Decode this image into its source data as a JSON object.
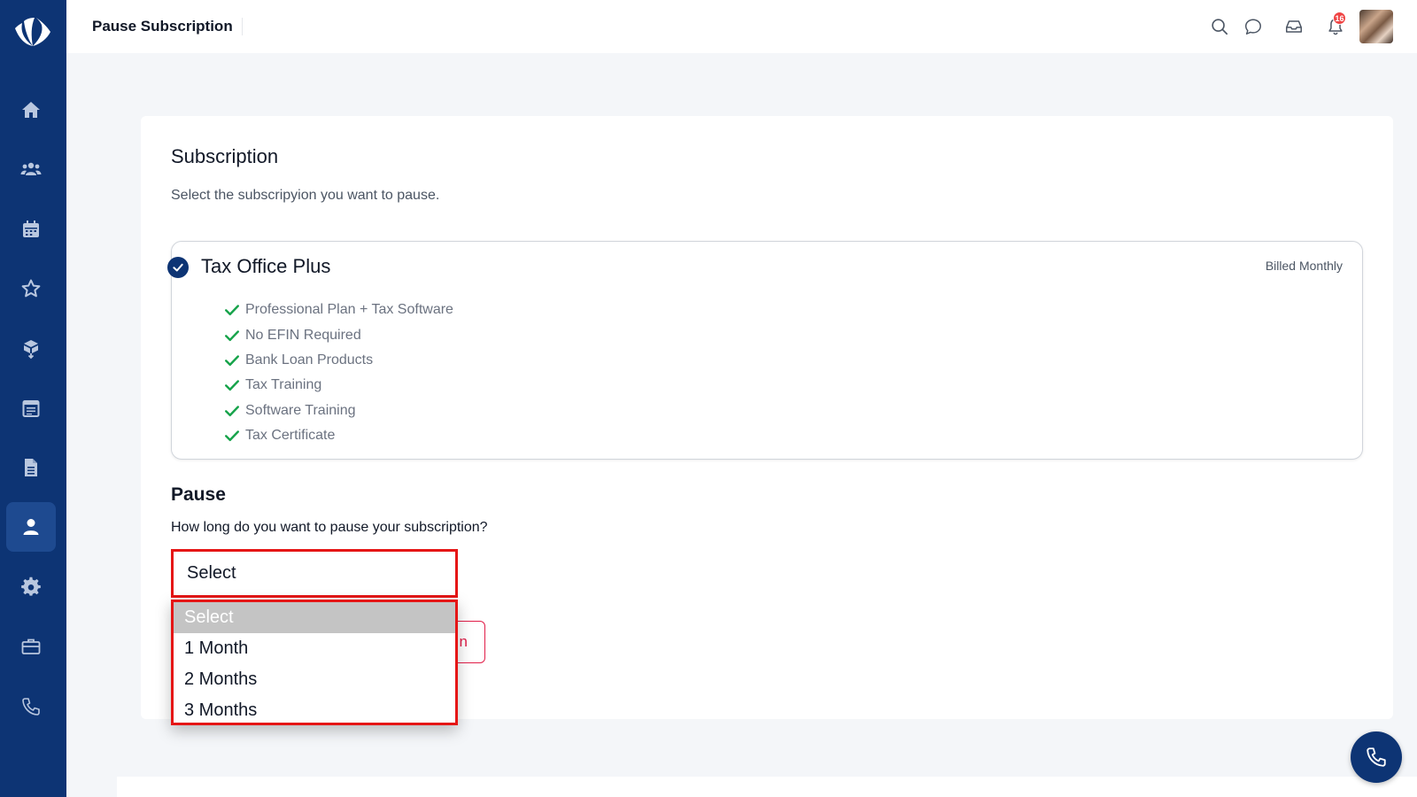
{
  "header": {
    "title": "Pause Subscription",
    "notification_count": "16",
    "icons": [
      "search-icon",
      "chat-icon",
      "inbox-icon",
      "bell-icon"
    ]
  },
  "sidebar": {
    "items": [
      {
        "name": "home",
        "icon": "home-icon"
      },
      {
        "name": "users",
        "icon": "users-icon"
      },
      {
        "name": "calendar",
        "icon": "calendar-icon"
      },
      {
        "name": "favorites",
        "icon": "star-icon"
      },
      {
        "name": "packages",
        "icon": "box-icon"
      },
      {
        "name": "schedule",
        "icon": "list-calendar-icon"
      },
      {
        "name": "documents",
        "icon": "document-icon"
      },
      {
        "name": "profile",
        "icon": "user-icon",
        "active": true
      },
      {
        "name": "settings",
        "icon": "gear-icon"
      },
      {
        "name": "briefcase",
        "icon": "briefcase-icon"
      },
      {
        "name": "phone",
        "icon": "phone-icon"
      }
    ]
  },
  "subscription": {
    "title": "Subscription",
    "subtitle": "Select the subscripyion you want to pause.",
    "plan": {
      "name": "Tax Office Plus",
      "billing": "Billed Monthly",
      "features": [
        "Professional Plan + Tax Software",
        "No EFIN Required",
        "Bank Loan Products",
        "Tax Training",
        "Software Training",
        "Tax Certificate"
      ]
    }
  },
  "pause": {
    "title": "Pause",
    "question": "How long do you want to pause your subscription?",
    "select_value": "Select",
    "options": [
      "Select",
      "1 Month",
      "2 Months",
      "3 Months"
    ],
    "hidden_button_tail": "n"
  },
  "colors": {
    "sidebar": "#0d3474",
    "accent_red": "#e51616",
    "check_green": "#16a34a",
    "badge_red": "#ef4444"
  }
}
